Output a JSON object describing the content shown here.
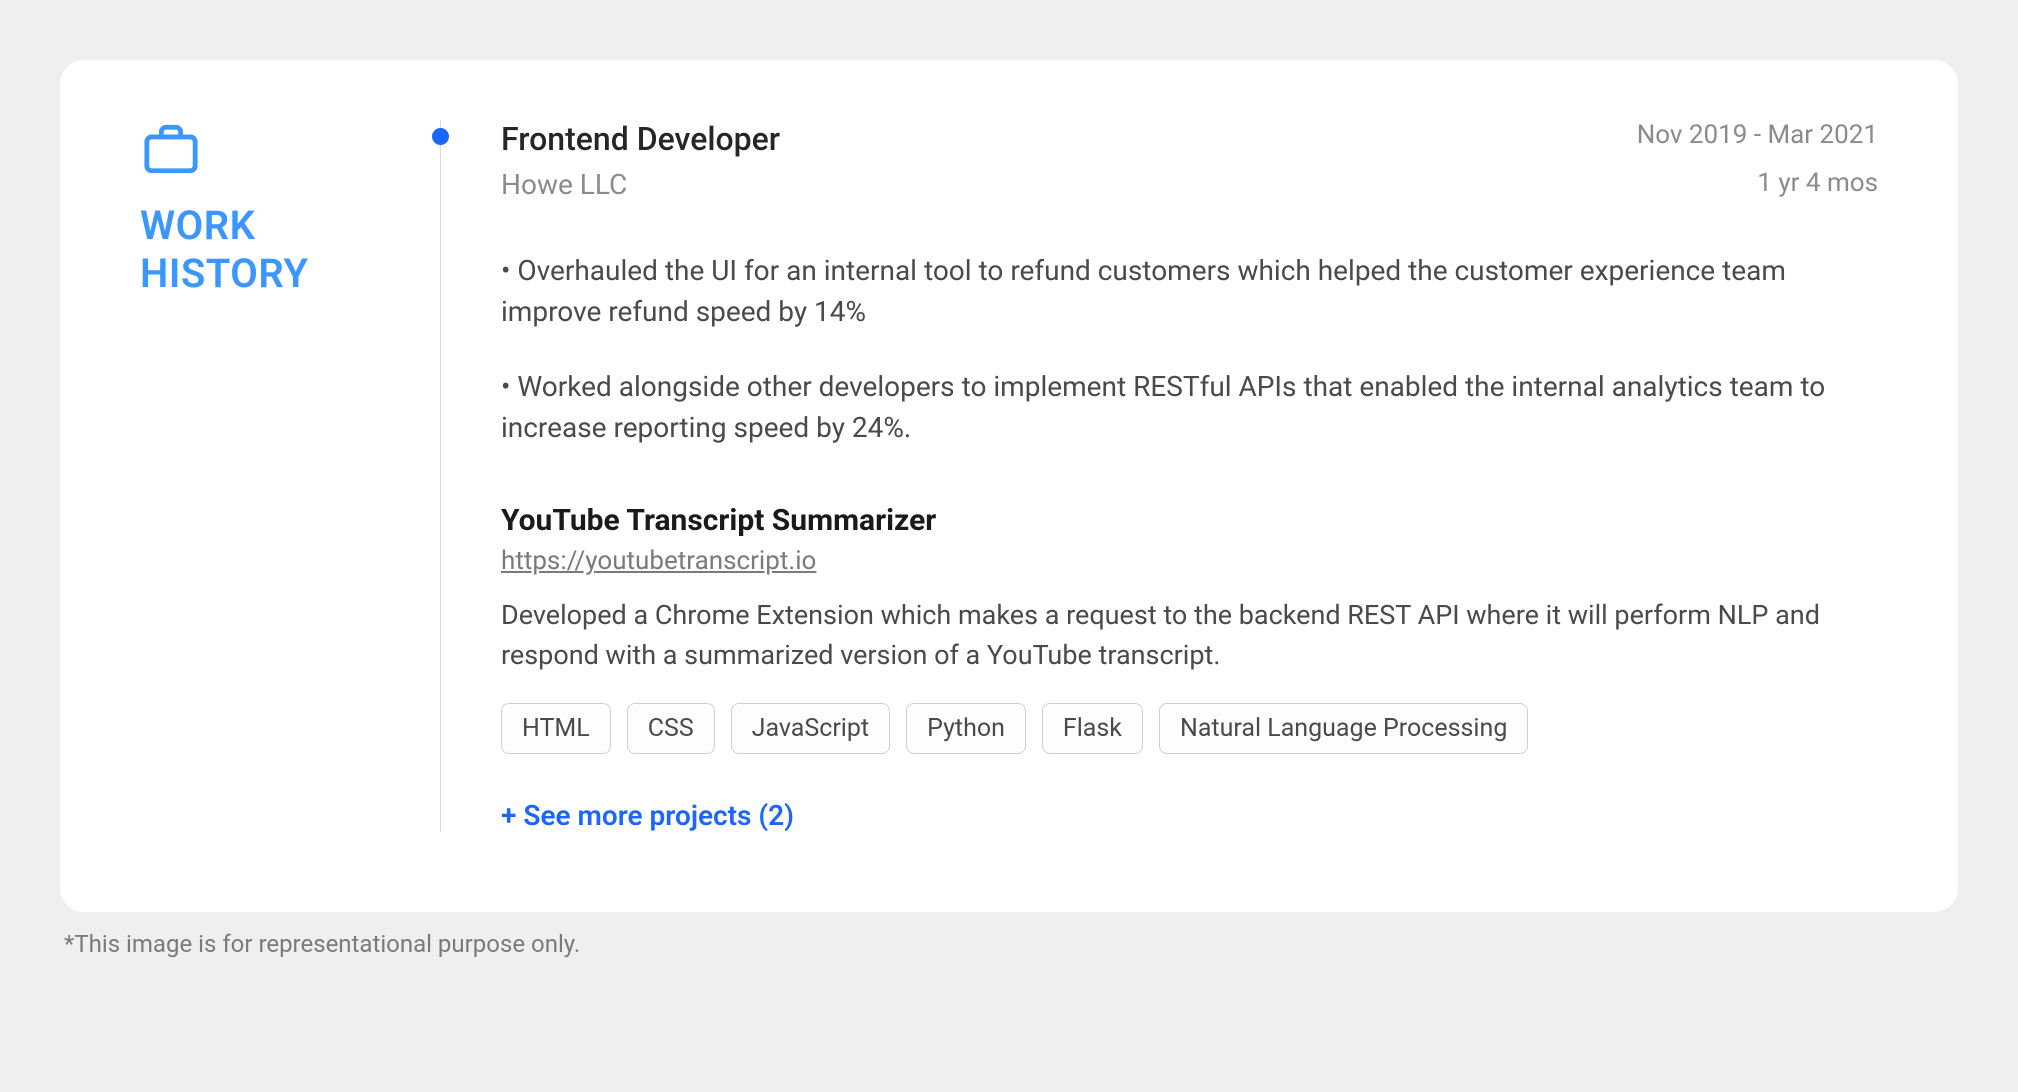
{
  "section_title_line1": "WORK",
  "section_title_line2": "HISTORY",
  "job": {
    "title": "Frontend Developer",
    "company": "Howe LLC",
    "date_range": "Nov 2019 - Mar 2021",
    "duration": "1 yr 4 mos",
    "bullets": [
      "• Overhauled the UI for an internal tool to refund customers which helped the customer experience team improve refund speed by 14%",
      "• Worked alongside other developers to implement RESTful APIs that enabled the internal analytics team to increase reporting speed by 24%."
    ]
  },
  "project": {
    "title": "YouTube Transcript Summarizer",
    "link": "https://youtubetranscript.io",
    "description": "Developed a Chrome Extension which makes a request to the backend REST API where it will perform NLP and respond with a summarized version of a YouTube transcript.",
    "tags": [
      "HTML",
      "CSS",
      "JavaScript",
      "Python",
      "Flask",
      "Natural Language Processing"
    ]
  },
  "see_more_label": "+ See more projects (2)",
  "disclaimer": "*This image is for representational purpose only."
}
